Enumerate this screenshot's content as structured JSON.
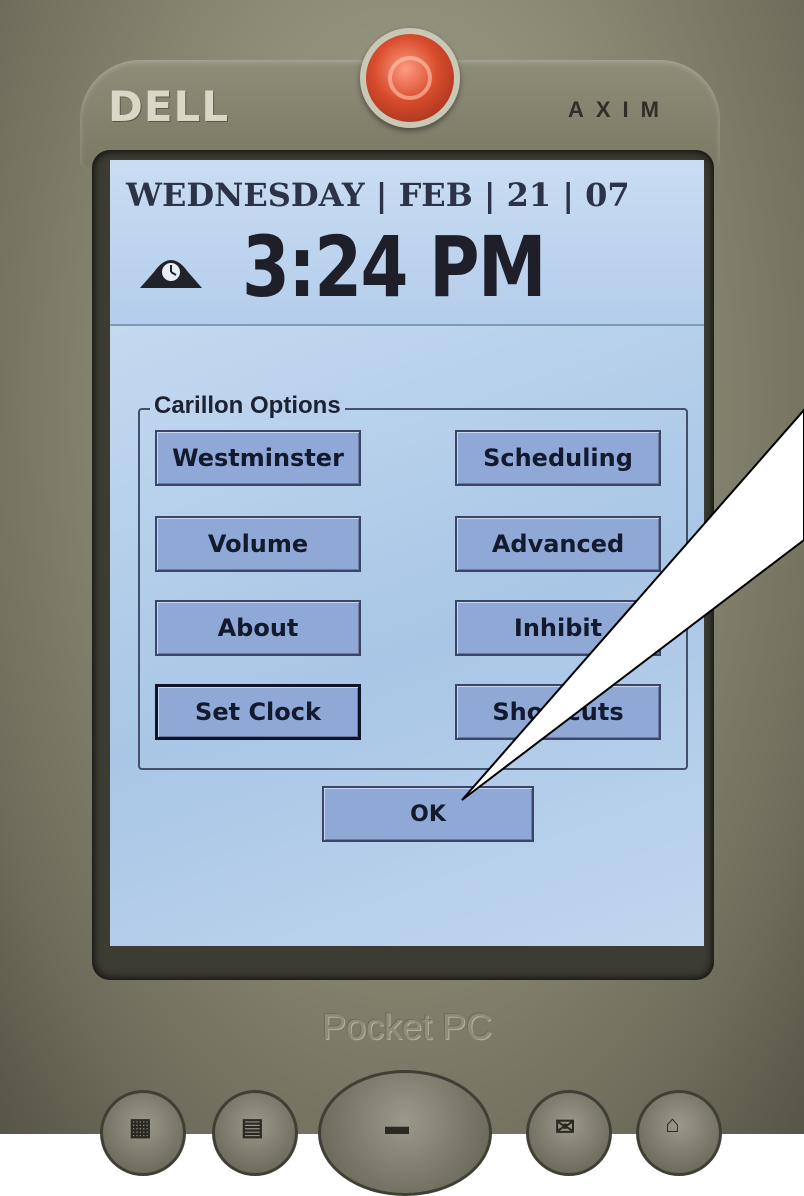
{
  "device": {
    "brand": "DELL",
    "model": "AXIM",
    "platform_label": "Pocket PC"
  },
  "header": {
    "date_line": "WEDNESDAY | FEB | 21 | 07",
    "time": "3:24 PM",
    "clock_icon": "mantel-clock-icon"
  },
  "carillon_options": {
    "title": "Carillon Options",
    "buttons": {
      "westminster": "Westminster",
      "scheduling": "Scheduling",
      "volume": "Volume",
      "advanced": "Advanced",
      "about": "About",
      "inhibit": "Inhibit",
      "set_clock": "Set Clock",
      "shortcuts": "Shortcuts"
    }
  },
  "dialog": {
    "ok_label": "OK"
  },
  "hardware_buttons": {
    "icons": [
      "calendar-icon",
      "contacts-icon",
      "navigation-pad-icon",
      "inbox-icon",
      "home-icon"
    ]
  },
  "colors": {
    "screen_bg": "#b8d1ec",
    "button_fill": "#8fa8d6",
    "power_button": "#d84c2c",
    "device_body": "#8b8a74"
  }
}
